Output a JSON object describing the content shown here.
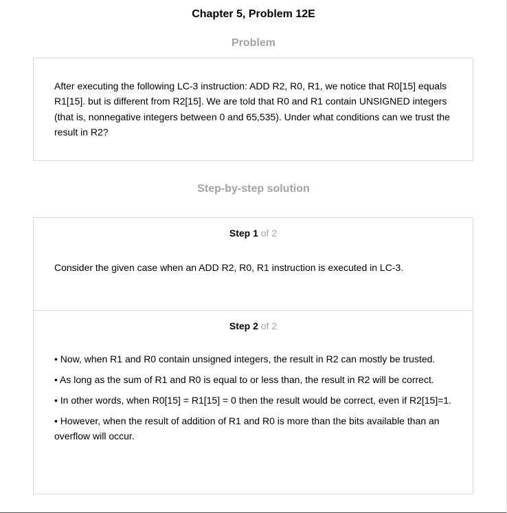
{
  "header": {
    "title": "Chapter 5, Problem 12E"
  },
  "problem": {
    "heading": "Problem",
    "text": "After executing the following LC-3 instruction: ADD R2, R0, R1, we notice that R0[15] equals R1[15]. but is different from R2[15]. We are told that R0 and R1 contain UNSIGNED integers (that is, nonnegative integers between 0 and 65,535). Under what conditions can we trust the result in R2?"
  },
  "solution": {
    "heading": "Step-by-step solution",
    "steps": [
      {
        "label": "Step 1",
        "of": "of 2",
        "body": "Consider the given case when an ADD R2, R0, R1 instruction is executed in LC-3."
      },
      {
        "label": "Step 2",
        "of": "of 2",
        "bullets": [
          "• Now, when R1 and R0 contain unsigned integers, the result in R2 can mostly be trusted.",
          "• As long as the sum of R1 and R0 is equal to or less than, the result in R2 will be correct.",
          "• In other words, when R0[15] = R1[15] = 0 then the result would be correct, even if R2[15]=1.",
          "• However, when the result of addition of R1 and R0 is more than the bits available than an overflow will occur."
        ]
      }
    ]
  }
}
